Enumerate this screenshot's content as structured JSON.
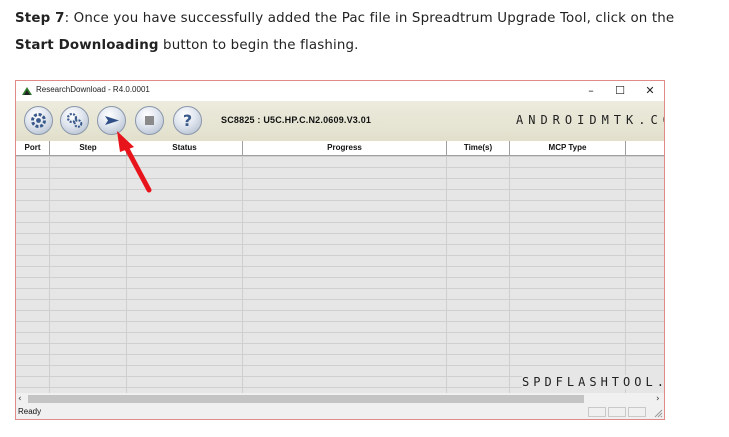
{
  "article": {
    "step_label": "Step 7",
    "line1_rest": ": Once you have successfully added the Pac file in Spreadtrum Upgrade Tool, click on the",
    "start_label": "Start Downloading",
    "line2_rest": " button to begin the flashing."
  },
  "window": {
    "title": "ResearchDownload - R4.0.0001",
    "controls": {
      "minimize": "–",
      "maximize": "☐",
      "close": "✕"
    }
  },
  "toolbar": {
    "buttons": [
      {
        "name": "settings",
        "icon": "gear-icon"
      },
      {
        "name": "load-packet",
        "icon": "gears-icon"
      },
      {
        "name": "start-downloading",
        "icon": "play-arrow-icon"
      },
      {
        "name": "stop-downloading",
        "icon": "stop-icon"
      },
      {
        "name": "help",
        "icon": "question-icon"
      }
    ],
    "version_text": "SC8825 : U5C.HP.C.N2.0609.V3.01",
    "watermark": "ANDROIDMTK.COM"
  },
  "grid": {
    "columns": [
      "Port",
      "Step",
      "Status",
      "Progress",
      "Time(s)",
      "MCP Type"
    ]
  },
  "watermark_bottom": "SPDFLASHTOOL.COM",
  "scrollbar": {
    "left_arrow": "‹",
    "right_arrow": "›"
  },
  "status_bar": {
    "text": "Ready"
  },
  "annotation": {
    "arrow_color": "#e8141b"
  }
}
